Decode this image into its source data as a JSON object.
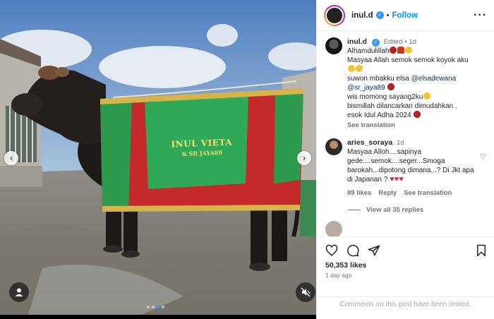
{
  "post": {
    "username": "inul.d",
    "follow_label": "Follow",
    "separator": "•",
    "more_label": "···"
  },
  "banner": {
    "line1": "INUL VIETA",
    "line2": "& SR JAYA89"
  },
  "caption": {
    "username": "inul.d",
    "edited": "Edited",
    "age": "1d",
    "line1": "Alhamdulillah",
    "line2": "Masyaa Allah semok semok koyok aku",
    "line3_text": "suwon mbakku elsa ",
    "mention1": "@elsadewana",
    "mention2": "@sr_jaya89",
    "line4": "wis momong sayang2ku",
    "line5": "bismillah dilancarkan dimudahkan .",
    "line6": "esok Idul Adha 2024",
    "see_translation": "See translation"
  },
  "comment": {
    "username": "aries_soraya",
    "age": "1d",
    "text": "Masyaa Alloh....sapinya gede....semok....seger...Smoga barokah...dipotong dimana...? Di Jkt apa di Japanan ?",
    "likes": "89 likes",
    "reply": "Reply",
    "see_translation": "See translation",
    "view_replies": "View all 35 replies"
  },
  "footer": {
    "likes_count": "50,353 likes",
    "timestamp": "1 day ago",
    "comments_limited": "Comments on this post have been limited."
  },
  "icons": {
    "like": "heart-icon",
    "comment": "comment-icon",
    "share": "share-icon",
    "save": "bookmark-icon",
    "tag": "user-tag-icon",
    "mute": "mute-icon",
    "prev": "chevron-left-icon",
    "next": "chevron-right-icon"
  },
  "carousel": {
    "slide_count": 4,
    "active_index": 2
  },
  "colors": {
    "accent": "#0095f6",
    "verified": "#3897f0"
  }
}
